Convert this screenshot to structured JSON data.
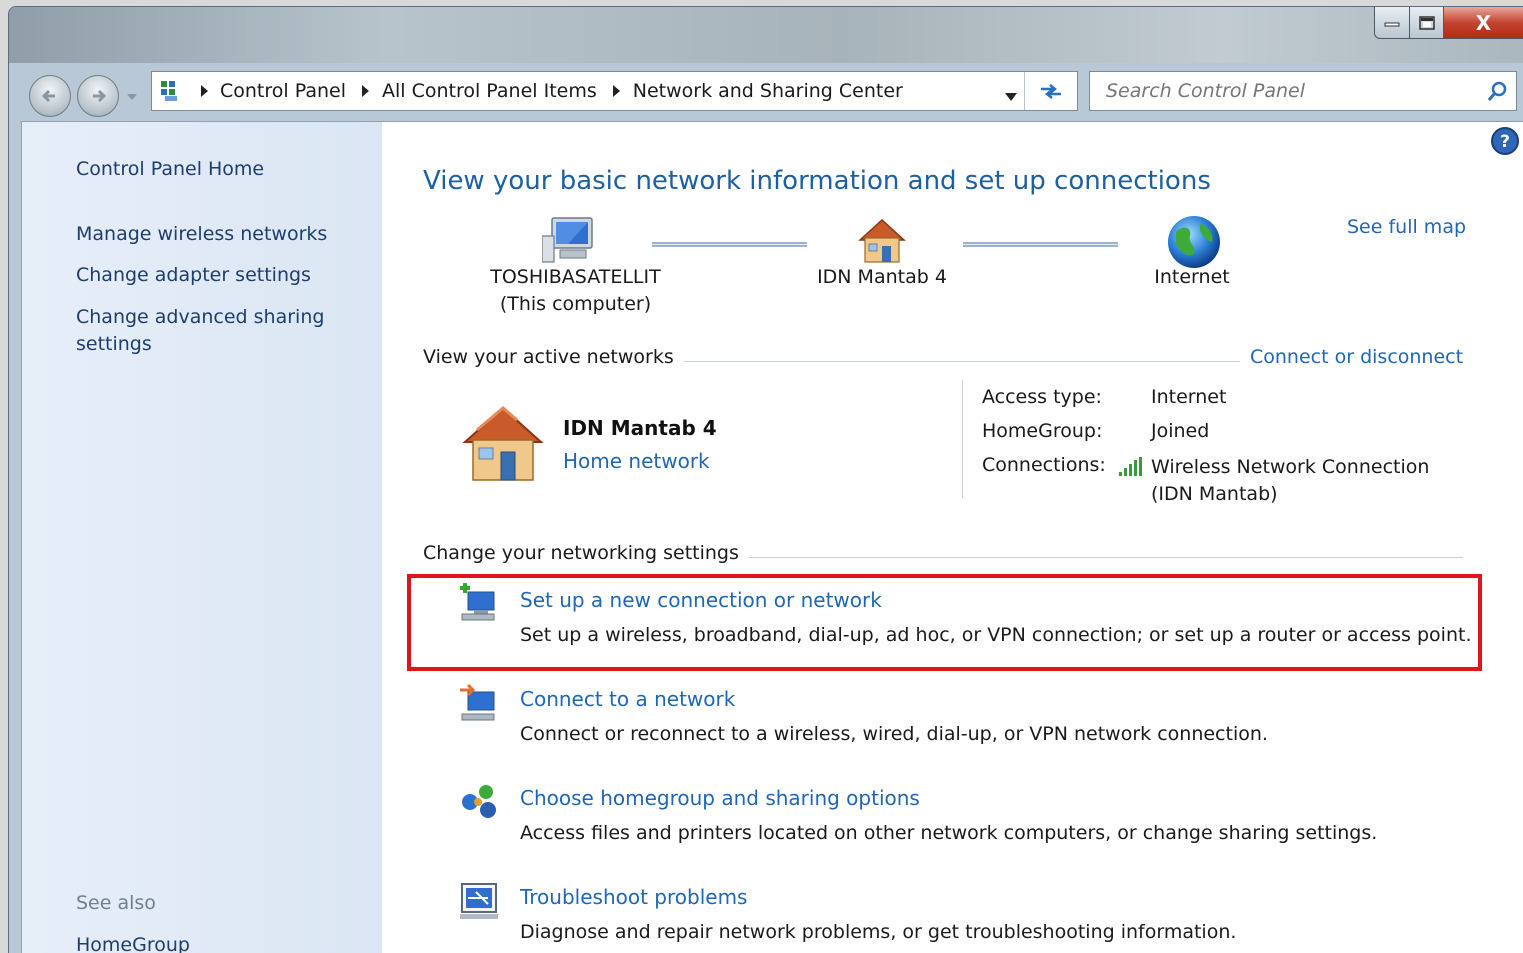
{
  "window": {
    "close_label": "X"
  },
  "address_bar": {
    "crumbs": [
      "Control Panel",
      "All Control Panel Items",
      "Network and Sharing Center"
    ]
  },
  "search": {
    "placeholder": "Search Control Panel"
  },
  "sidebar": {
    "home": "Control Panel Home",
    "items": [
      {
        "label": "Manage wireless networks"
      },
      {
        "label": "Change adapter settings"
      },
      {
        "label": "Change advanced sharing settings"
      }
    ],
    "see_also_label": "See also",
    "see_also": [
      {
        "label": "HomeGroup"
      }
    ]
  },
  "main": {
    "title": "View your basic network information and set up connections",
    "see_full_map": "See full map",
    "map": {
      "computer_name": "TOSHIBASATELLIT",
      "computer_sub": "(This computer)",
      "network_name": "IDN Mantab  4",
      "internet": "Internet"
    },
    "active_networks": {
      "label": "View your active networks",
      "action": "Connect or disconnect",
      "network_name": "IDN Mantab  4",
      "network_type": "Home network",
      "access_type_label": "Access type:",
      "access_type_value": "Internet",
      "homegroup_label": "HomeGroup:",
      "homegroup_value": "Joined",
      "connections_label": "Connections:",
      "connections_value_line1": "Wireless Network Connection",
      "connections_value_line2": "(IDN Mantab)"
    },
    "change_settings": {
      "label": "Change your networking settings",
      "tasks": [
        {
          "title": "Set up a new connection or network",
          "desc": "Set up a wireless, broadband, dial-up, ad hoc, or VPN connection; or set up a router or access point."
        },
        {
          "title": "Connect to a network",
          "desc": "Connect or reconnect to a wireless, wired, dial-up, or VPN network connection."
        },
        {
          "title": "Choose homegroup and sharing options",
          "desc": "Access files and printers located on other network computers, or change sharing settings."
        },
        {
          "title": "Troubleshoot problems",
          "desc": "Diagnose and repair network problems, or get troubleshooting information."
        }
      ]
    }
  },
  "colors": {
    "link": "#1f66b5",
    "title": "#1d5fa3",
    "highlight": "#e0141a",
    "sidebar_bg": "#dbe6f4"
  },
  "icons": {
    "back": "back-arrow-icon",
    "forward": "forward-arrow-icon",
    "refresh": "refresh-icon",
    "search": "magnifier-icon",
    "help": "help-icon",
    "computer": "computer-icon",
    "house": "house-icon",
    "globe": "globe-icon",
    "signal": "signal-bars-icon"
  }
}
